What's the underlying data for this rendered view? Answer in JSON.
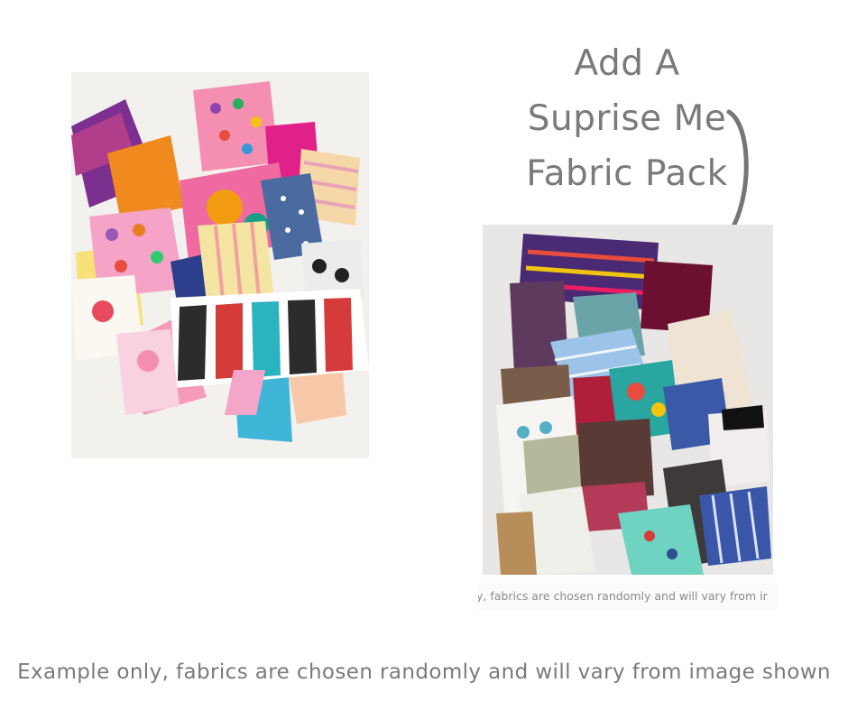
{
  "headline": {
    "lines": [
      "Add A",
      "Suprise Me",
      "Fabric Pack"
    ],
    "color": "#7a7a7a"
  },
  "images": {
    "left_photo_name": "colorful-fabric-scraps-photo",
    "right_photo_name": "surprise-fabric-pack-photo"
  },
  "photo_caption": "y, fabrics are chosen randomly and will vary from ir",
  "footer_caption": "Example only, fabrics are chosen randomly and will vary from image shown",
  "icons": {
    "arrow": "curved-arrow-icon"
  }
}
